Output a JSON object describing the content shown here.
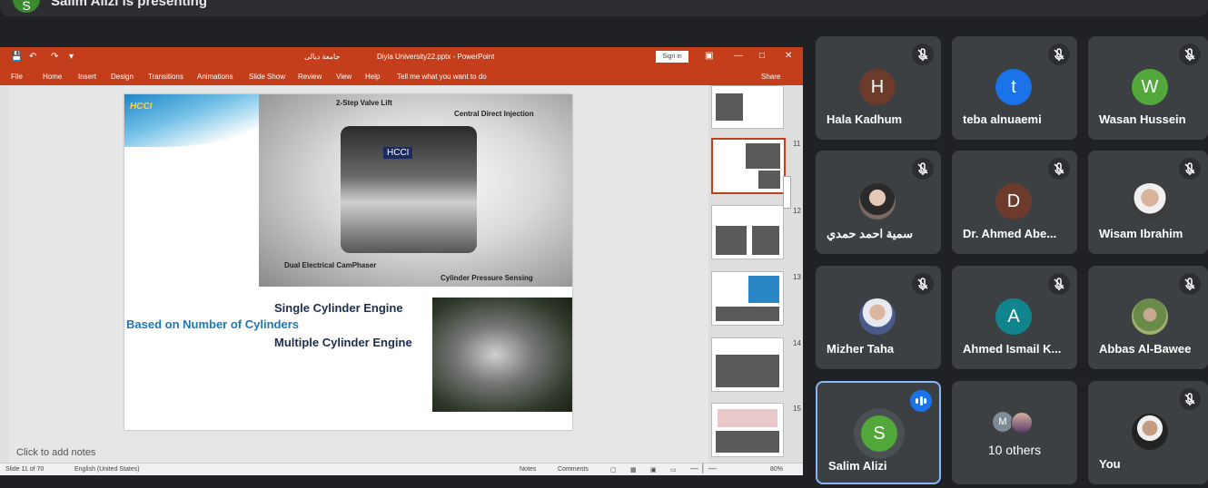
{
  "presenting": {
    "avatar_initial": "S",
    "text": "Salim Alizi is presenting"
  },
  "powerpoint": {
    "title_arabic": "جامعة ديالى",
    "document_title": "Diyla University22.pptx  -  PowerPoint",
    "signin": "Sign in",
    "ribbon_tabs": [
      "File",
      "Home",
      "Insert",
      "Design",
      "Transitions",
      "Animations",
      "Slide Show",
      "Review",
      "View",
      "Help"
    ],
    "tell_me": "Tell me what you want to do",
    "share": "Share",
    "slide": {
      "logo": "HCCI",
      "engine_brand": "HCCI",
      "callouts": [
        "2-Step Valve Lift",
        "Central Direct Injection",
        "Dual Electrical CamPhaser",
        "Cylinder Pressure Sensing"
      ],
      "based_on": "Based on Number of Cylinders",
      "single": "Single Cylinder Engine",
      "multiple": "Multiple Cylinder Engine"
    },
    "notes_placeholder": "Click to add notes",
    "thumbnail_numbers": [
      "11",
      "12",
      "13",
      "14",
      "15"
    ],
    "status": {
      "slide": "Slide 11 of 70",
      "language": "English (United States)",
      "notes": "Notes",
      "comments": "Comments",
      "zoom": "80%"
    }
  },
  "participants": [
    {
      "name": "Hala Kadhum",
      "initial": "H",
      "color": "#6d3b2b",
      "muted": true
    },
    {
      "name": "teba alnuaemi",
      "initial": "t",
      "color": "#1a73e8",
      "muted": true
    },
    {
      "name": "Wasan Hussein",
      "initial": "W",
      "color": "#52a83a",
      "muted": true
    },
    {
      "name": "سمية احمد حمدي",
      "initial": "",
      "color": "#8a6a5a",
      "muted": true,
      "photo": true
    },
    {
      "name": "Dr. Ahmed Abe...",
      "initial": "D",
      "color": "#6d3b2b",
      "muted": true
    },
    {
      "name": "Wisam Ibrahim",
      "initial": "",
      "color": "#8c7a6a",
      "muted": true,
      "photo": true
    },
    {
      "name": "Mizher Taha",
      "initial": "",
      "color": "#7a7a80",
      "muted": true,
      "photo": true
    },
    {
      "name": "Ahmed Ismail K...",
      "initial": "A",
      "color": "#11858e",
      "muted": true
    },
    {
      "name": "Abbas Al-Bawee",
      "initial": "",
      "color": "#7a9a6a",
      "muted": true,
      "photo": true
    },
    {
      "name": "Salim Alizi",
      "initial": "S",
      "color": "#52a83a",
      "speaking": true
    },
    {
      "name": "10 others",
      "initial": "M",
      "others": true
    },
    {
      "name": "You",
      "initial": "",
      "color": "#5a4a3a",
      "muted": true,
      "photo": true
    }
  ],
  "icons": {
    "mute": "mic-off-icon",
    "speaking": "audio-level-icon"
  }
}
